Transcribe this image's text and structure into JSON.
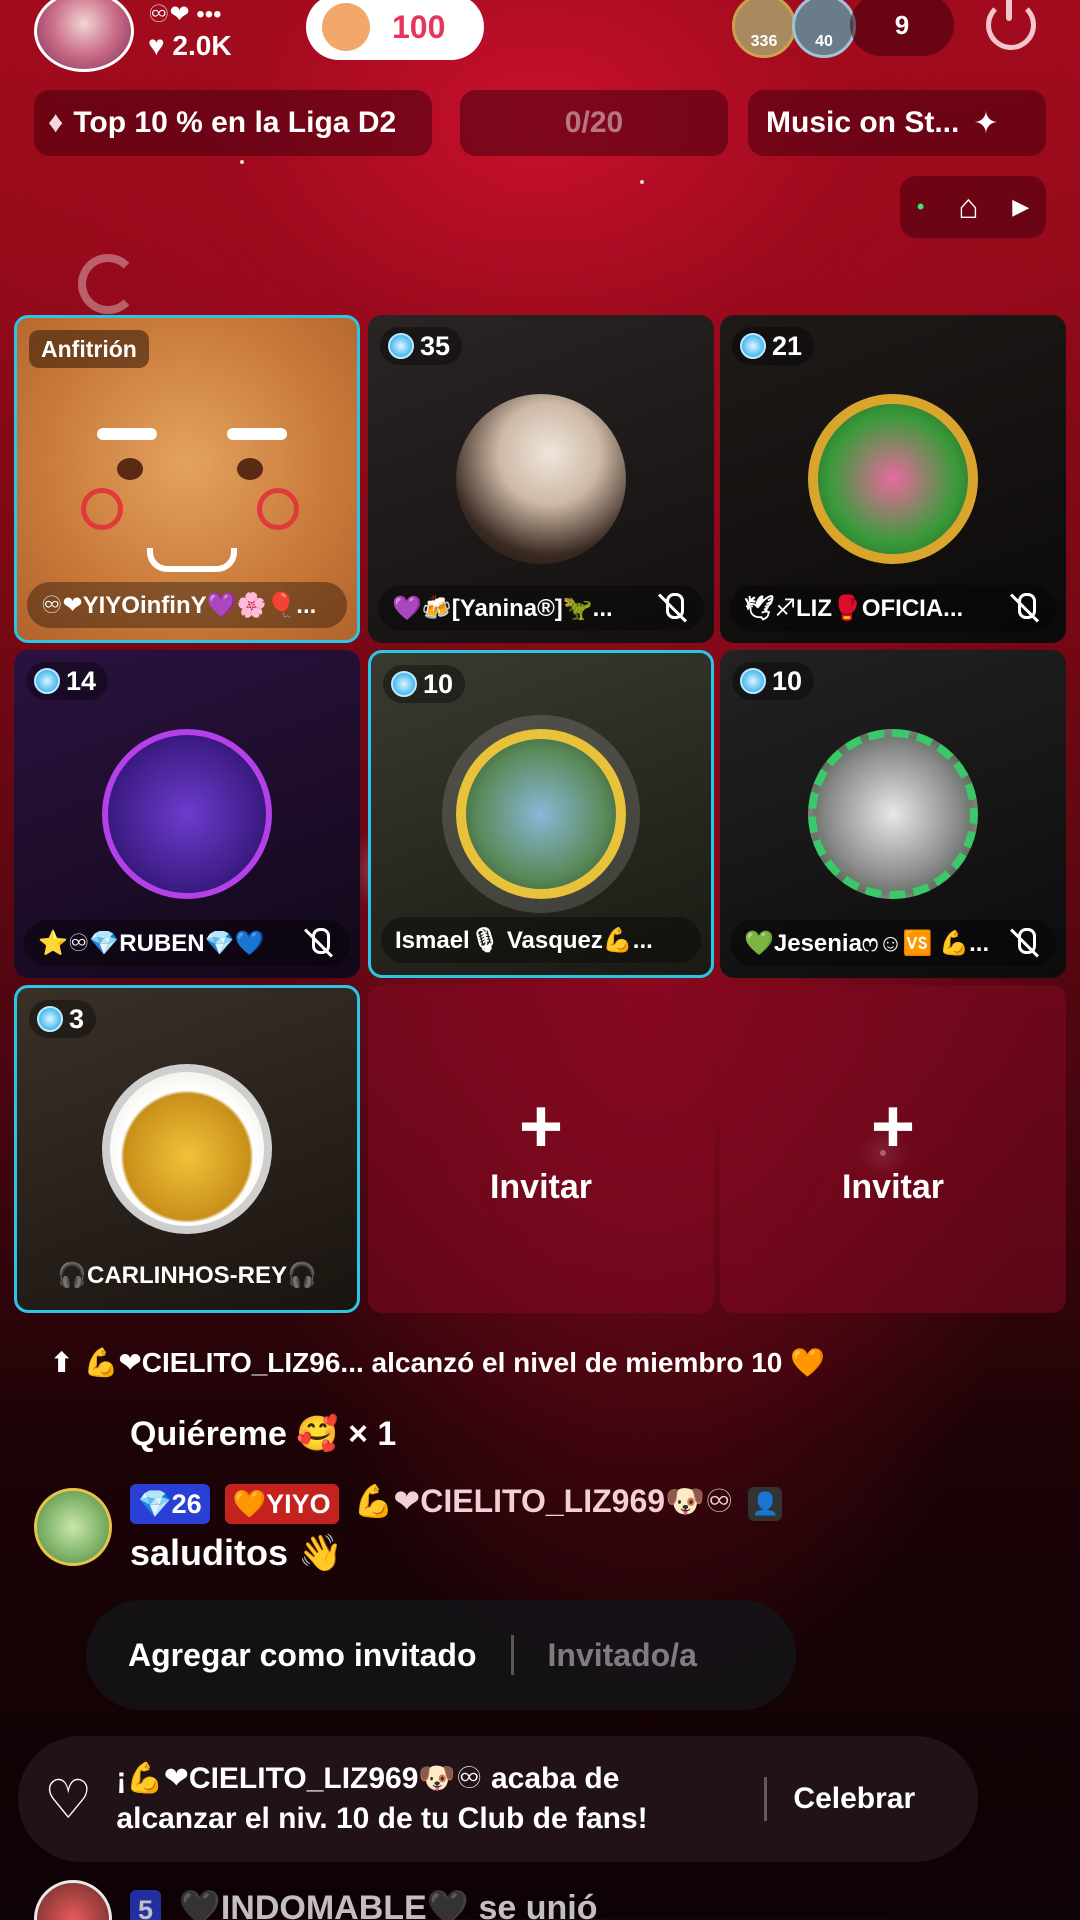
{
  "header": {
    "host_badges": "♾❤ •••",
    "host_likes": "♥ 2.0K",
    "likes_pill_value": "100",
    "viewer_avatars": [
      {
        "count": "336"
      },
      {
        "count": "40"
      }
    ],
    "viewer_count": "9"
  },
  "pills": {
    "league": "Top 10 % en la Liga D2",
    "progress": "0/20",
    "music": "Music on St...",
    "stream_icons": [
      "•",
      "⌂",
      "▶"
    ]
  },
  "grid": {
    "host_label": "Anfitrión",
    "tiles": [
      {
        "name": "♾❤YIYOinfinY💜🌸🎈...",
        "count": "",
        "host": true
      },
      {
        "name": "💜🍻[Yanina®]🦖...",
        "count": "35",
        "muted": true
      },
      {
        "name": "🕊♐LIZ🥊OFICIA...",
        "count": "21",
        "muted": true
      },
      {
        "name": "⭐♾💎RUBEN💎💙",
        "count": "14",
        "muted": true
      },
      {
        "name": "Ismael🎙 Vasquez💪...",
        "count": "10"
      },
      {
        "name": "💚Jeseniaෆ☺🆚 💪...",
        "count": "10",
        "muted": true
      },
      {
        "name": "🎧CARLINHOS-REY🎧",
        "count": "3"
      },
      {
        "invite_label": "Invitar"
      },
      {
        "invite_label": "Invitar"
      }
    ]
  },
  "chat": {
    "level_up": "💪❤CIELITO_LIZ96... alcanzó el nivel de miembro 10 🧡",
    "gift": "Quiéreme 🥰 × 1",
    "message_badges": {
      "level": "💎26",
      "fan": "🧡YIYO"
    },
    "message_user": "💪❤CIELITO_LIZ969🐶♾",
    "message_text": "saluditos 👋",
    "joined_badge": "5",
    "joined_text": "🖤INDOMABLE🖤 se unió"
  },
  "action_bar": {
    "add_guest": "Agregar como invitado",
    "guest_status": "Invitado/a"
  },
  "notification": {
    "text_line1": "¡💪❤CIELITO_LIZ969🐶♾ acaba de",
    "text_line2": "alcanzar el niv. 10 de tu Club de fans!",
    "celebrate": "Celebrar"
  },
  "colors": {
    "accent_cyan": "#29c6e6",
    "likes_red": "#e8345a",
    "badge_blue": "#2a3fd6",
    "badge_red": "#c4221f"
  }
}
